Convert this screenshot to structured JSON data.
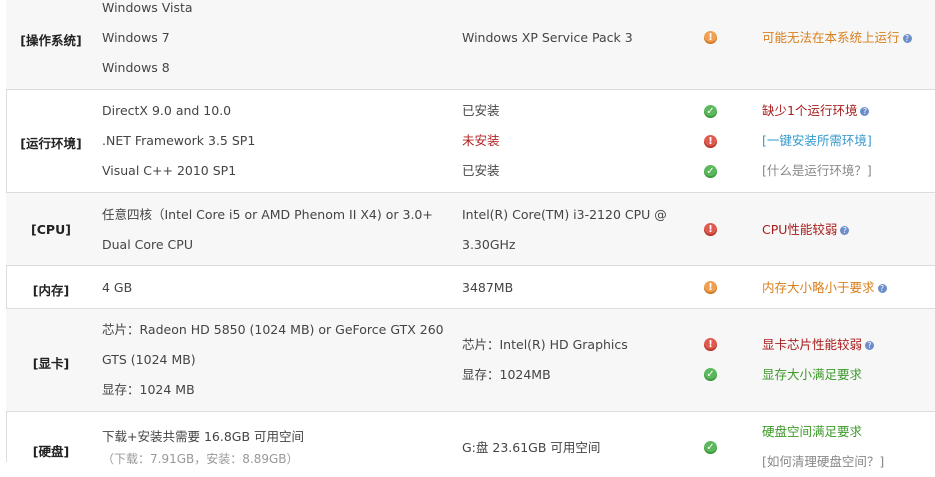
{
  "sections": {
    "os": {
      "label": "[操作系统]",
      "req": [
        "Windows Vista",
        "Windows 7",
        "Windows 8"
      ],
      "current": "Windows XP Service Pack 3",
      "status": "warn",
      "note": "可能无法在本系统上运行",
      "note_color": "#d9801e"
    },
    "runtime": {
      "label": "[运行环境]",
      "req": [
        "DirectX 9.0 and 10.0",
        ".NET Framework 3.5 SP1",
        "Visual C++ 2010 SP1"
      ],
      "current": [
        "已安装",
        "未安装",
        "已安装"
      ],
      "status": [
        "ok",
        "err",
        "ok"
      ],
      "notes": [
        "缺少1个运行环境",
        "[一键安装所需环境]",
        "[什么是运行环境？]"
      ]
    },
    "cpu": {
      "label": "[CPU]",
      "req": [
        "任意四核（Intel Core i5 or AMD Phenom II X4) or 3.0+",
        "Dual Core CPU"
      ],
      "current": [
        "Intel(R) Core(TM) i3-2120 CPU @",
        "3.30GHz"
      ],
      "status": "err",
      "note": "CPU性能较弱"
    },
    "memory": {
      "label": "[内存]",
      "req": "4 GB",
      "current": "3487MB",
      "status": "warn",
      "note": "内存大小略小于要求"
    },
    "gpu": {
      "label": "[显卡]",
      "req": [
        "芯片：Radeon HD 5850 (1024 MB) or GeForce GTX 260",
        "GTS (1024 MB)",
        "显存：1024 MB"
      ],
      "current": [
        "芯片：Intel(R) HD Graphics",
        "显存：1024MB"
      ],
      "status": [
        "err",
        "ok"
      ],
      "notes": [
        "显卡芯片性能较弱",
        "显存大小满足要求"
      ]
    },
    "disk": {
      "label": "[硬盘]",
      "req": [
        "下载+安装共需要  16.8GB 可用空间",
        "（下载：7.91GB，安装：8.89GB）"
      ],
      "current": "G:盘  23.61GB 可用空间",
      "status": "ok",
      "notes": [
        "硬盘空间满足要求",
        "[如何清理硬盘空间？]"
      ]
    }
  },
  "colors": {
    "ok": "#5cb85c",
    "err": "#e05a4f",
    "warn": "#f0a050",
    "note_red": "#a81c1c",
    "note_green": "#3d9a2a",
    "note_blue": "#3399cc",
    "note_gray": "#888888",
    "help_icon": "#6d8ec9"
  },
  "icons": {
    "ok": "check-circle-icon",
    "err": "error-circle-icon",
    "warn": "warning-circle-icon",
    "help": "help-circle-icon"
  }
}
